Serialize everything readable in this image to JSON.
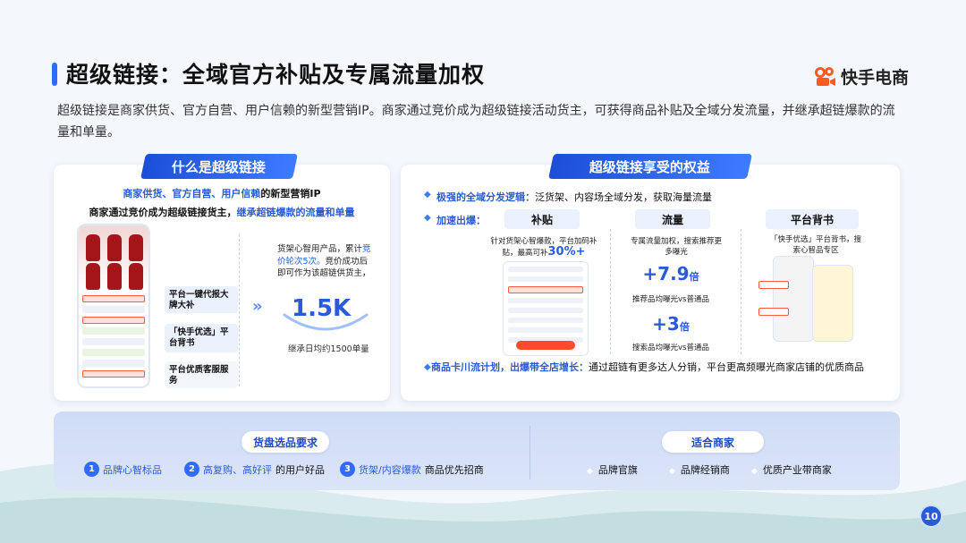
{
  "title": "超级链接：全域官方补贴及专属流量加权",
  "logo_text": "快手电商",
  "intro": "超级链接是商家供货、官方自营、用户信赖的新型营销IP。商家通过竞价成为超级链接活动货主，可获得商品补贴及全域分发流量，并继承超链爆款的流量和单量。",
  "left_card": {
    "tab": "什么是超级链接",
    "line1_blue": "商家供货、官方自营、用户信赖",
    "line1_rest": "的新型营销IP",
    "line2_black": "商家通过竞价成为超级链接货主，",
    "line2_blue": "继承超链爆款的流量和单量",
    "features": [
      "平台一键代报大牌大补",
      "「快手优选」平台背书",
      "平台优质客服服务"
    ],
    "desc_a": "货架心智用产品，累计",
    "desc_b": "竞价轮次5次。",
    "desc_c": "竞价成功后即可作为该超链供货主，",
    "big_value": "1.5K",
    "big_sub": "继承日均约1500单量"
  },
  "right_card": {
    "tab": "超级链接享受的权益",
    "row1_label": "极强的全域分发逻辑：",
    "row1_text": "泛货架、内容场全域分发，获取海量流量",
    "row2_label": "加速出爆：",
    "columns": [
      {
        "head": "补贴",
        "text": "针对货架心智爆款，平台加码补贴，最高可补",
        "value": "30%+"
      },
      {
        "head": "流量",
        "text": "专属流量加权，搜索推荐更多曝光",
        "value1": "+7.9",
        "unit1": "倍",
        "note1": "推荐品均曝光vs普通品",
        "value2": "+3",
        "unit2": "倍",
        "note2": "搜索品均曝光vs普通品"
      },
      {
        "head": "平台背书",
        "text": "「快手优选」平台背书，搜索心智品专区"
      }
    ],
    "row3_label": "商品卡川流计划，出爆带全店增长：",
    "row3_text": "通过超链有更多达人分销，平台更高频曝光商家店铺的优质商品"
  },
  "bottom": {
    "left_pill": "货盘选品要求",
    "right_pill": "适合商家",
    "requirements": [
      {
        "num": "1",
        "hl": "品牌心智标品",
        "rest": ""
      },
      {
        "num": "2",
        "hl": "高复购、高好评",
        "rest": "的用户好品"
      },
      {
        "num": "3",
        "hl": "货架/内容爆款",
        "rest": "商品优先招商"
      }
    ],
    "merchants": [
      "品牌官旗",
      "品牌经销商",
      "优质产业带商家"
    ]
  },
  "page_number": "10",
  "colors": {
    "accent": "#2a5bd7",
    "tab": "#1c4fd6",
    "logo": "#ff5a1f"
  }
}
